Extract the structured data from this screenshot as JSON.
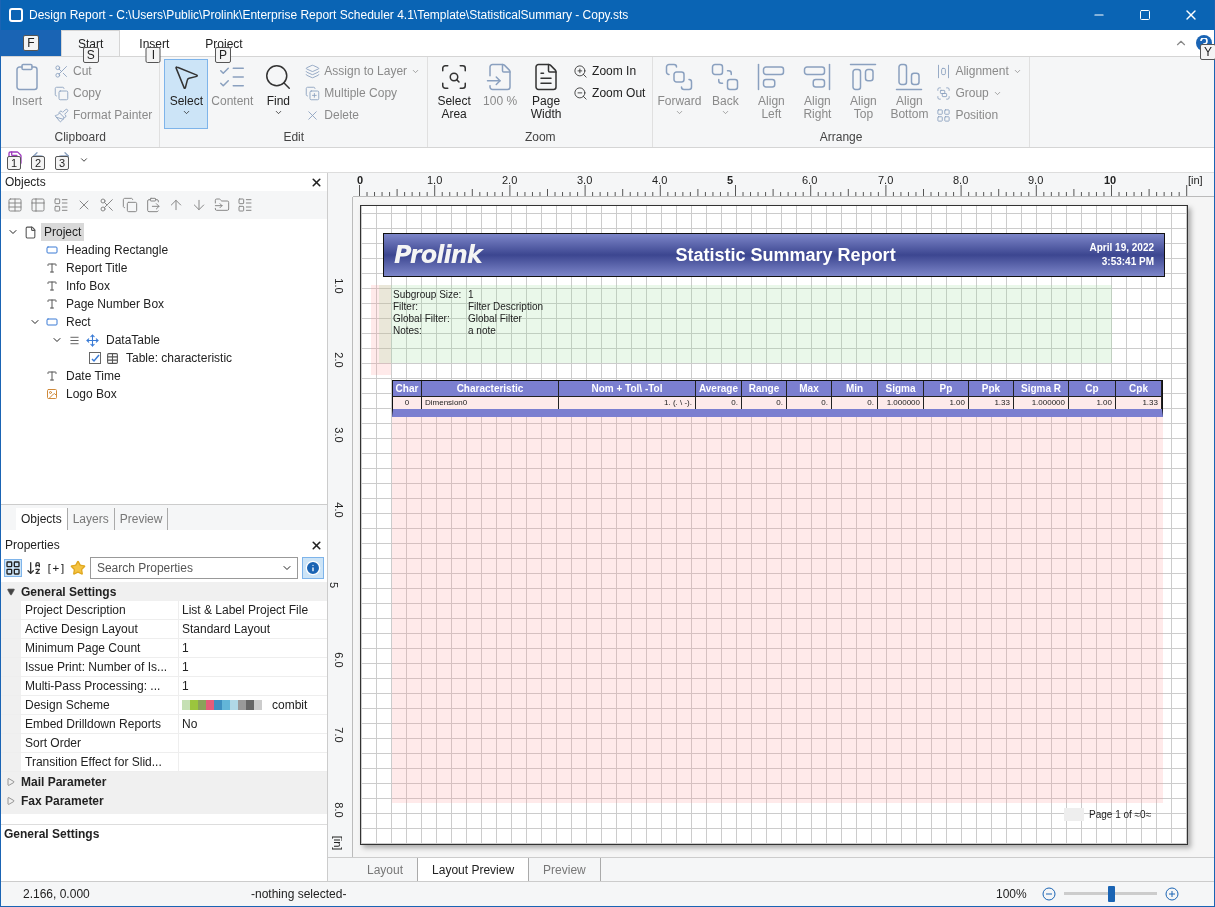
{
  "window": {
    "title": "Design Report - C:\\Users\\Public\\Prolink\\Enterprise Report Scheduler 4.1\\Template\\StatisticalSummary - Copy.sts"
  },
  "ribbon_tabs": [
    {
      "label": "Start",
      "keytip": "S",
      "selected": true
    },
    {
      "label": "Insert",
      "keytip": "I",
      "selected": false
    },
    {
      "label": "Project",
      "keytip": "P",
      "selected": false
    }
  ],
  "file_tab": {
    "keytip": "F"
  },
  "help_keytip": "Y",
  "ribbon_groups": [
    {
      "title": "Clipboard",
      "items": [
        {
          "kind": "large",
          "label": "Insert",
          "disabled": true
        },
        {
          "kind": "small",
          "label": "Cut",
          "disabled": true
        },
        {
          "kind": "small",
          "label": "Copy",
          "disabled": true
        },
        {
          "kind": "small",
          "label": "Format Painter",
          "disabled": true
        }
      ]
    },
    {
      "title": "Edit",
      "items": [
        {
          "kind": "large",
          "label": "Select",
          "disabled": false,
          "selected": true,
          "dropdown": true
        },
        {
          "kind": "large",
          "label": "Content",
          "disabled": true
        },
        {
          "kind": "large",
          "label": "Find",
          "disabled": false,
          "dropdown": true
        },
        {
          "kind": "small",
          "label": "Assign to Layer",
          "disabled": true,
          "dropdown": true
        },
        {
          "kind": "small",
          "label": "Multiple Copy",
          "disabled": true
        },
        {
          "kind": "small",
          "label": "Delete",
          "disabled": true
        }
      ]
    },
    {
      "title": "Zoom",
      "items": [
        {
          "kind": "large",
          "label": "Select Area",
          "disabled": false
        },
        {
          "kind": "large",
          "label": "100 %",
          "disabled": true
        },
        {
          "kind": "large",
          "label": "Page Width",
          "disabled": false
        },
        {
          "kind": "small",
          "label": "Zoom In",
          "disabled": false
        },
        {
          "kind": "small",
          "label": "Zoom Out",
          "disabled": false
        }
      ]
    },
    {
      "title": "Arrange",
      "items": [
        {
          "kind": "large",
          "label": "Forward",
          "disabled": true,
          "dropdown": true
        },
        {
          "kind": "large",
          "label": "Back",
          "disabled": true,
          "dropdown": true
        },
        {
          "kind": "large",
          "label": "Align Left",
          "disabled": true
        },
        {
          "kind": "large",
          "label": "Align Right",
          "disabled": true
        },
        {
          "kind": "large",
          "label": "Align Top",
          "disabled": true
        },
        {
          "kind": "large",
          "label": "Align Bottom",
          "disabled": true
        },
        {
          "kind": "small",
          "label": "Alignment",
          "disabled": true,
          "dropdown": true
        },
        {
          "kind": "small",
          "label": "Group",
          "disabled": true,
          "dropdown": true
        },
        {
          "kind": "small",
          "label": "Position",
          "disabled": true
        }
      ]
    }
  ],
  "quick_access": [
    {
      "keytip": "1"
    },
    {
      "keytip": "2"
    },
    {
      "keytip": "3"
    }
  ],
  "objects_panel": {
    "title": "Objects",
    "tree": [
      {
        "label": "Project",
        "kind": "page",
        "selected": true,
        "expanded": true,
        "children": [
          {
            "label": "Heading Rectangle",
            "kind": "rect",
            "selected": false
          },
          {
            "label": "Report Title",
            "kind": "text",
            "selected": false
          },
          {
            "label": "Info Box",
            "kind": "text",
            "selected": false
          },
          {
            "label": "Page Number Box",
            "kind": "text",
            "selected": false
          },
          {
            "label": "Rect",
            "kind": "rect",
            "selected": false,
            "expanded": true,
            "children": [
              {
                "label": "DataTable",
                "kind": "container",
                "selected": false,
                "expanded": true,
                "children": [
                  {
                    "label": "Table: characteristic",
                    "kind": "table",
                    "selected": false,
                    "checked": true
                  }
                ]
              }
            ]
          },
          {
            "label": "Date Time",
            "kind": "text",
            "selected": false
          },
          {
            "label": "Logo Box",
            "kind": "image",
            "selected": false
          }
        ]
      }
    ],
    "tabs": [
      {
        "label": "Objects",
        "selected": true
      },
      {
        "label": "Layers",
        "selected": false
      },
      {
        "label": "Preview",
        "selected": false
      }
    ]
  },
  "properties_panel": {
    "title": "Properties",
    "expand_label": "[+]",
    "search": {
      "placeholder": "Search Properties"
    },
    "sections": [
      {
        "title": "General Settings",
        "expanded": true,
        "rows": [
          {
            "name": "Project Description",
            "value": "List & Label Project File"
          },
          {
            "name": "Active Design Layout",
            "value": "Standard Layout"
          },
          {
            "name": "Minimum Page Count",
            "value": "1"
          },
          {
            "name": "Issue Print: Number of Is...",
            "value": "1"
          },
          {
            "name": "Multi-Pass Processing: ...",
            "value": "1"
          },
          {
            "name": "Design Scheme",
            "value": "combit",
            "swatches": [
              {
                "color": "#c5e0b4"
              },
              {
                "color": "#9bc53d"
              },
              {
                "color": "#8aa35a"
              },
              {
                "color": "#e35d7a"
              },
              {
                "color": "#3e8fc0"
              },
              {
                "color": "#62b5d8"
              },
              {
                "color": "#b0d8e6"
              },
              {
                "color": "#999999"
              },
              {
                "color": "#666666"
              },
              {
                "color": "#cccccc"
              }
            ]
          },
          {
            "name": "Embed Drilldown Reports",
            "value": "No"
          },
          {
            "name": "Sort Order"
          },
          {
            "name": "Transition Effect for Slid..."
          }
        ]
      },
      {
        "title": "Mail Parameter",
        "expanded": false
      },
      {
        "title": "Fax Parameter",
        "expanded": false
      }
    ],
    "description_title": "General Settings"
  },
  "rulers": {
    "horizontal": [
      "0",
      "1.0",
      "2.0",
      "3.0",
      "4.0",
      "5",
      "6.0",
      "7.0",
      "8.0",
      "9.0",
      "10"
    ],
    "horizontal_unit": "[in]",
    "vertical": [
      "1.0",
      "2.0",
      "3.0",
      "4.0",
      "5",
      "6.0",
      "7.0",
      "8.0"
    ],
    "vertical_unit": "[in]"
  },
  "report": {
    "logo": "Prolink",
    "title": "Statistic Summary Report",
    "date": "April 19, 2022",
    "time": "3:53:41 PM",
    "info": [
      {
        "label": "Subgroup Size:",
        "value": "1"
      },
      {
        "label": "Filter:",
        "value": "Filter Description"
      },
      {
        "label": "Global Filter:",
        "value": "Global Filter"
      },
      {
        "label": "Notes:",
        "value": "a note"
      }
    ],
    "table": {
      "columns": [
        "Char",
        "Characteristic",
        "Nom + Tol\\ -Tol",
        "Average",
        "Range",
        "Max",
        "Min",
        "Sigma",
        "Pp",
        "Ppk",
        "Sigma R",
        "Cp",
        "Cpk"
      ],
      "rows": [
        [
          "0",
          "Dimension0",
          "1. (. \\ -).",
          "0.",
          "0.",
          "0.",
          "0.",
          "1.000000",
          "1.00",
          "1.33",
          "1.000000",
          "1.00",
          "1.33"
        ]
      ]
    },
    "page_number": "Page 1 of ≈0≈"
  },
  "view_tabs": [
    {
      "label": "Layout",
      "selected": false
    },
    {
      "label": "Layout Preview",
      "selected": true
    },
    {
      "label": "Preview",
      "selected": false
    }
  ],
  "status_bar": {
    "position": "2.166, 0.000",
    "selection": "-nothing selected-",
    "zoom": "100%",
    "zoom_level": {
      "level": 0.5
    }
  }
}
